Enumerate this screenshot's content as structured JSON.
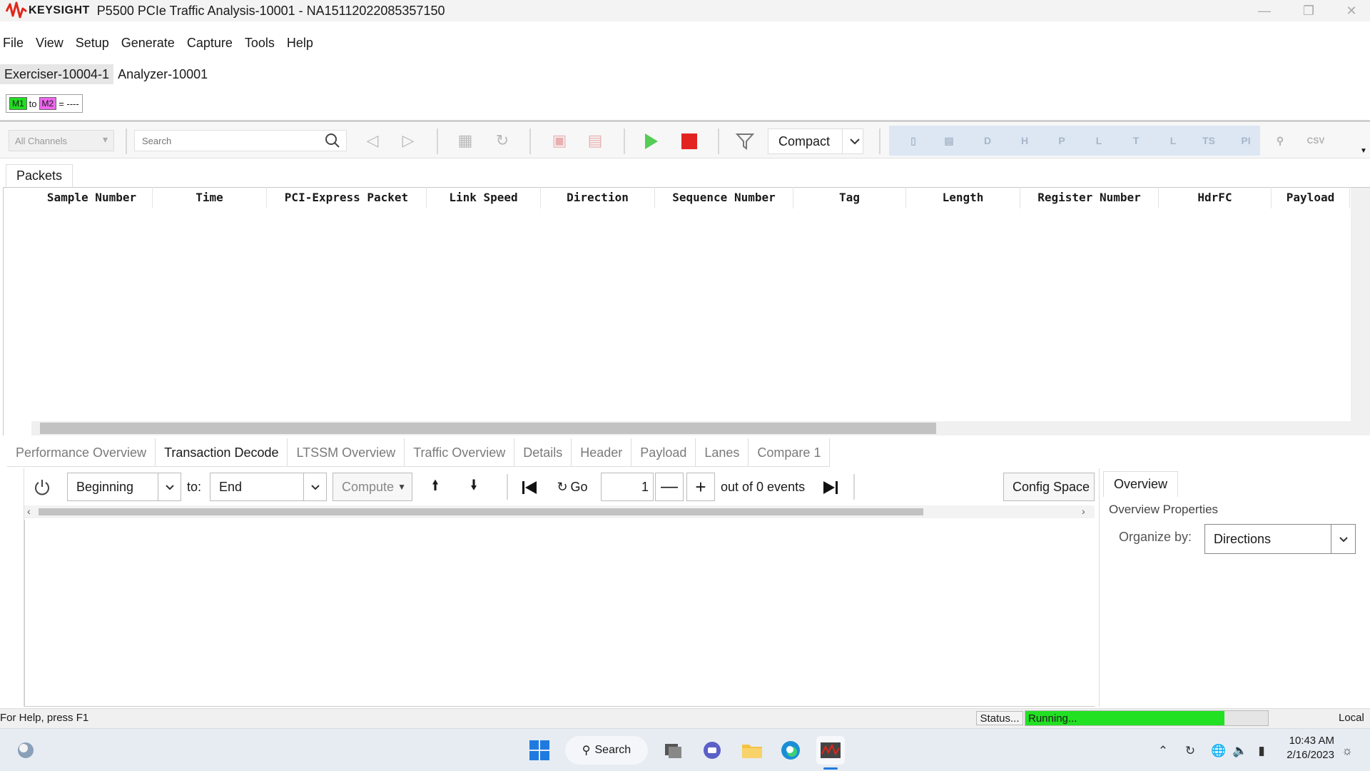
{
  "titlebar": {
    "brand": "KEYSIGHT",
    "title": "P5500 PCIe Traffic Analysis-10001 - NA15112022085357150",
    "brand_color": "#e1261c"
  },
  "menu": [
    "File",
    "View",
    "Setup",
    "Generate",
    "Capture",
    "Tools",
    "Help"
  ],
  "device_tabs": [
    "Exerciser-10004-1",
    "Analyzer-10001"
  ],
  "markers": {
    "m1": "M1",
    "to": "to",
    "m2": "M2",
    "value": "= ----"
  },
  "toolbar": {
    "channels": "All Channels",
    "search_placeholder": "Search",
    "view_mode": "Compact",
    "right_icons": [
      "export",
      "export-all",
      "decode-d",
      "header-h",
      "payload-p",
      "lanes-l",
      "trace-t",
      "link-l",
      "ts",
      "pi",
      "zoom",
      "csv"
    ]
  },
  "packets": {
    "tab": "Packets",
    "columns": [
      "Sample Number",
      "Time",
      "PCI-Express Packet",
      "Link Speed",
      "Direction",
      "Sequence Number",
      "Tag",
      "Length",
      "Register Number",
      "HdrFC",
      "Payload"
    ]
  },
  "bottom_tabs": [
    "Performance Overview",
    "Transaction Decode",
    "LTSSM Overview",
    "Traffic Overview",
    "Details",
    "Header",
    "Payload",
    "Lanes",
    "Compare 1"
  ],
  "active_bottom_tab": "Transaction Decode",
  "decode": {
    "from": "Beginning",
    "to_label": "to:",
    "to": "End",
    "compute": "Compute",
    "go": "Go",
    "event_index": "1",
    "events_text": "out of 0 events",
    "config_space": "Config Space S"
  },
  "overview": {
    "tab": "Overview",
    "props_title": "Overview Properties",
    "organize_label": "Organize by:",
    "organize_value": "Directions"
  },
  "statusbar": {
    "help": "For Help, press F1",
    "status_label": "Status...",
    "progress_text": "Running...",
    "progress_fraction": 0.82,
    "progress_color": "#22e022",
    "mode": "Local"
  },
  "taskbar": {
    "search": "Search",
    "time": "10:43 AM",
    "date": "2/16/2023",
    "apps": [
      "windows-start-icon",
      "task-view-icon",
      "teams-icon",
      "file-explorer-icon",
      "edge-icon",
      "keysight-app-icon"
    ]
  }
}
